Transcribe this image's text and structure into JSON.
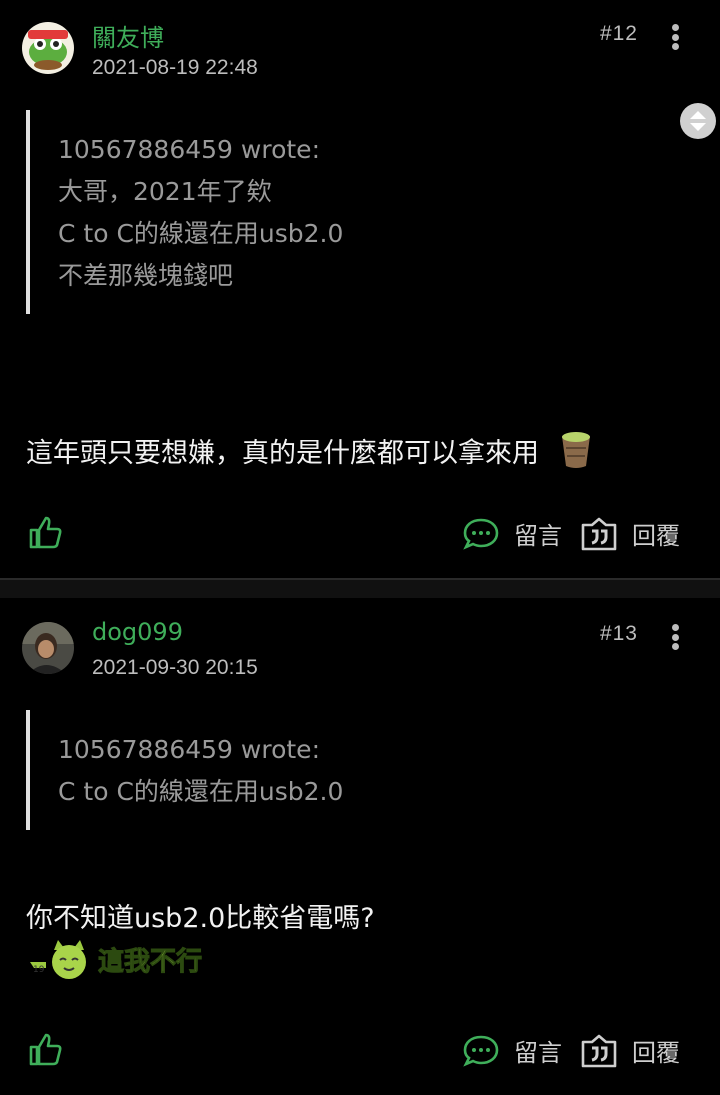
{
  "posts": [
    {
      "author": "關友博",
      "date": "2021-08-19 22:48",
      "floor": "#12",
      "quote": {
        "header": "10567886459 wrote:",
        "lines": [
          "大哥，2021年了欸",
          "C to C的線還在用usb2.0",
          "不差那幾塊錢吧"
        ]
      },
      "body": "這年頭只要想嫌，真的是什麼都可以拿來用",
      "emoji": "tea-cup-icon",
      "comment_label": "留言",
      "reply_label": "回覆"
    },
    {
      "author": "dog099",
      "date": "2021-09-30 20:15",
      "floor": "#13",
      "quote": {
        "header": "10567886459 wrote:",
        "lines": [
          "C to C的線還在用usb2.0"
        ]
      },
      "body": "你不知道usb2.0比較省電嗎?",
      "sticker_text": "這我不行",
      "comment_label": "留言",
      "reply_label": "回覆"
    }
  ],
  "colors": {
    "accent": "#3fae5a",
    "background": "#000000",
    "quote_text": "#9a9a9a"
  }
}
